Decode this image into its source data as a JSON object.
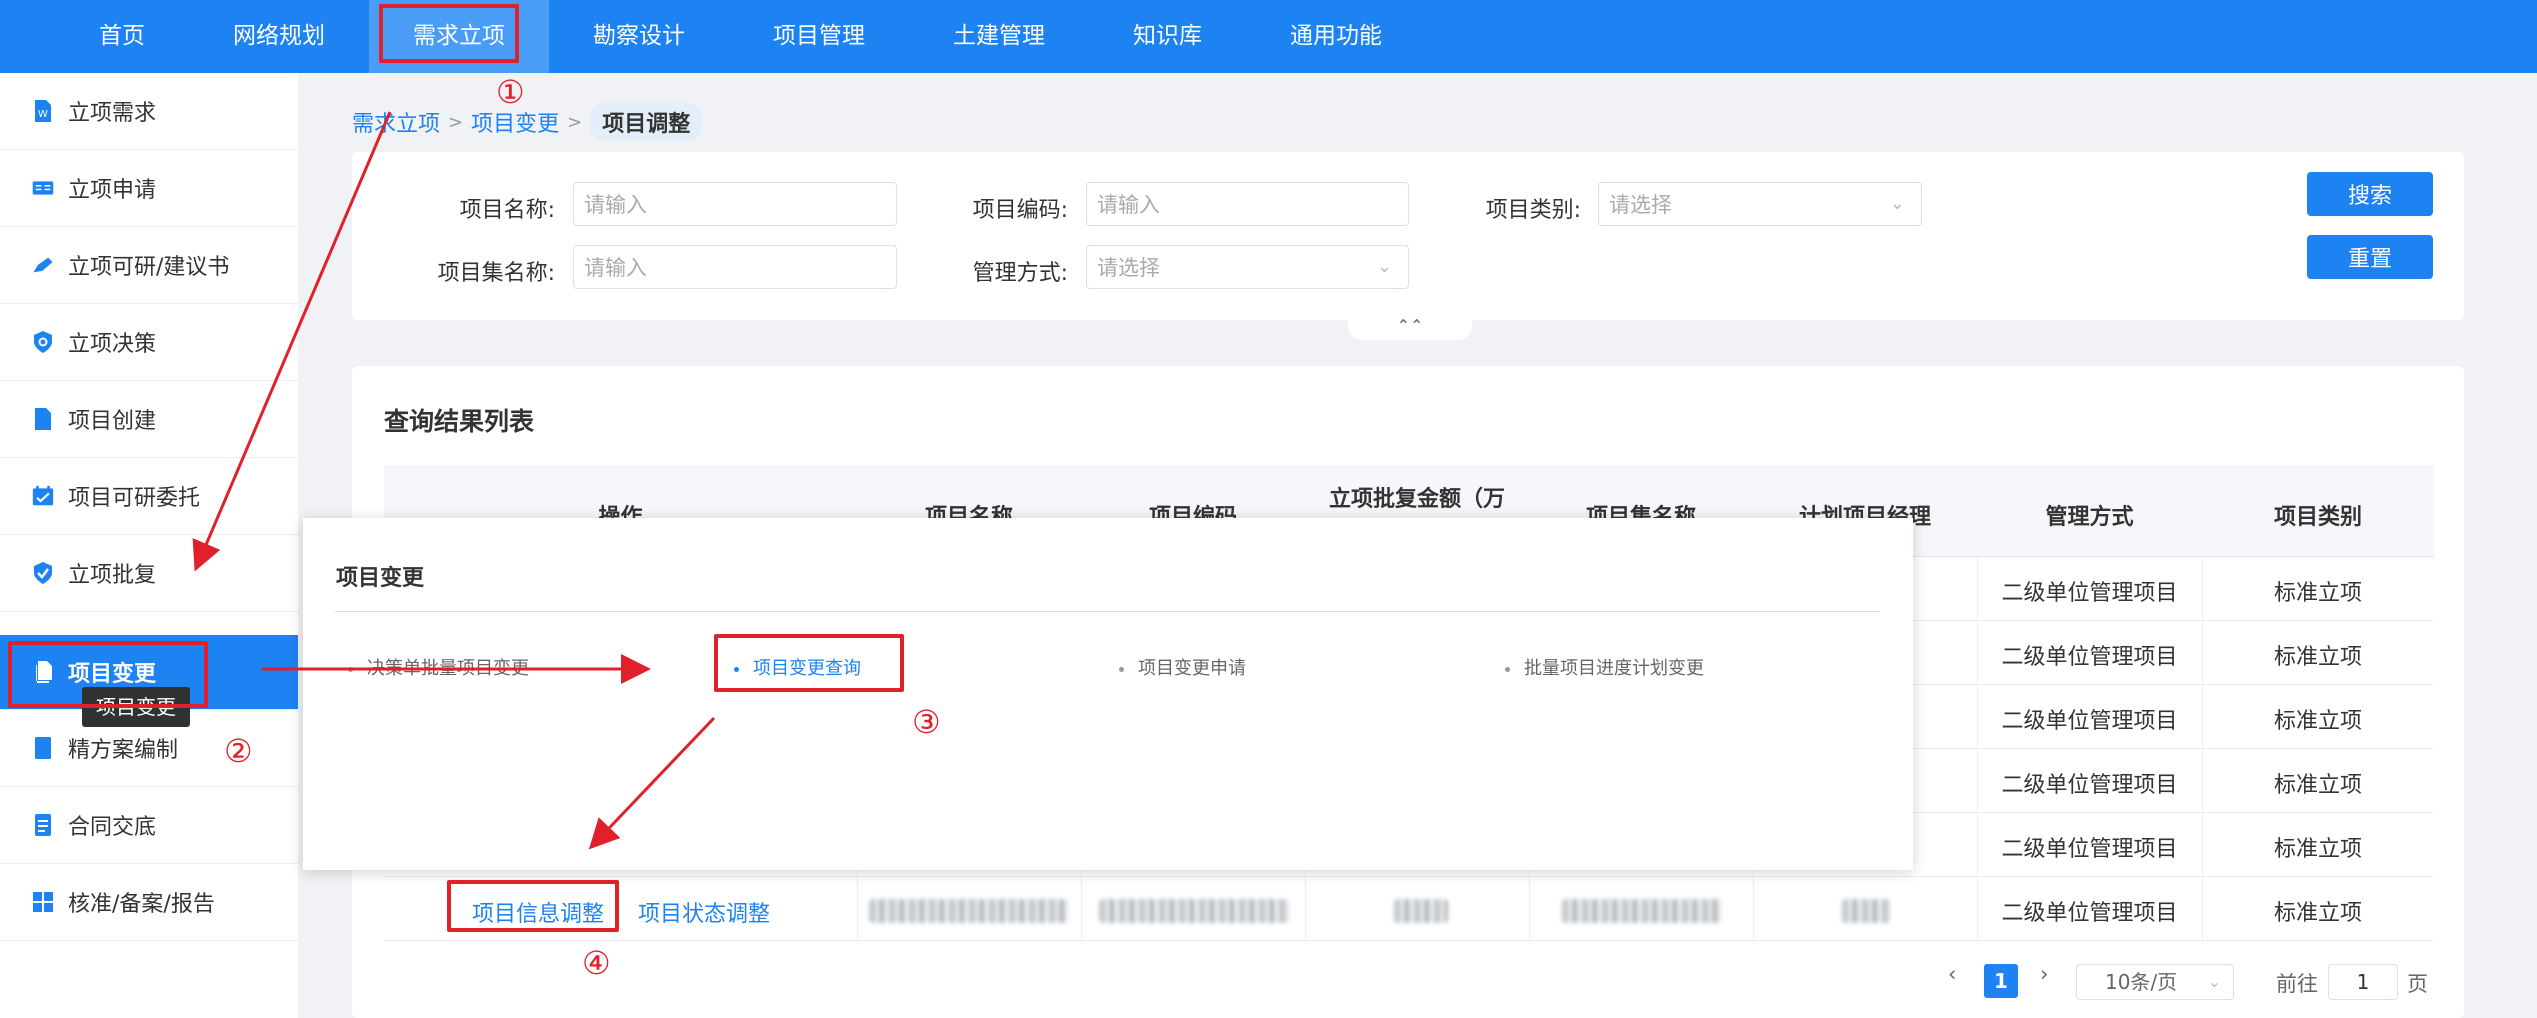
{
  "topnav": {
    "items": [
      "首页",
      "网络规划",
      "需求立项",
      "勘察设计",
      "项目管理",
      "土建管理",
      "知识库",
      "通用功能"
    ]
  },
  "sidebar": {
    "items": [
      "立项需求",
      "立项申请",
      "立项可研/建议书",
      "立项决策",
      "项目创建",
      "项目可研委托",
      "立项批复",
      "项目变更",
      "精方案编制",
      "合同交底",
      "核准/备案/报告"
    ],
    "tooltip": "项目变更"
  },
  "breadcrumb": {
    "level1": "需求立项",
    "level2": "项目变更",
    "current": "项目调整"
  },
  "search": {
    "project_name_label": "项目名称:",
    "project_name_placeholder": "请输入",
    "project_code_label": "项目编码:",
    "project_code_placeholder": "请输入",
    "project_type_label": "项目类别:",
    "project_type_placeholder": "请选择",
    "project_set_label": "项目集名称:",
    "project_set_placeholder": "请输入",
    "mgmt_mode_label": "管理方式:",
    "mgmt_mode_placeholder": "请选择",
    "search_button": "搜索",
    "reset_button": "重置"
  },
  "results": {
    "title": "查询结果列表",
    "columns": [
      "操作",
      "项目名称",
      "项目编码",
      "立项批复金额（万",
      "项目集名称",
      "计划项目经理",
      "管理方式",
      "项目类别"
    ],
    "rows": [
      {
        "mgmt": "二级单位管理项目",
        "type": "标准立项"
      },
      {
        "mgmt": "二级单位管理项目",
        "type": "标准立项"
      },
      {
        "mgmt": "二级单位管理项目",
        "type": "标准立项"
      },
      {
        "mgmt": "二级单位管理项目",
        "type": "标准立项"
      },
      {
        "mgmt": "二级单位管理项目",
        "type": "标准立项"
      },
      {
        "mgmt": "二级单位管理项目",
        "type": "标准立项"
      }
    ],
    "op_info_adjust": "项目信息调整",
    "op_status_adjust": "项目状态调整"
  },
  "pagination": {
    "current_page": "1",
    "page_size": "10条/页",
    "goto_label": "前往",
    "goto_value": "1",
    "page_suffix": "页"
  },
  "dropdown": {
    "title": "项目变更",
    "items": [
      "决策单批量项目变更",
      "项目变更查询",
      "项目变更申请",
      "批量项目进度计划变更"
    ]
  },
  "annotations": [
    "①",
    "②",
    "③",
    "④"
  ],
  "colors": {
    "primary": "#1d82f2",
    "annotation_red": "#e0202a"
  }
}
